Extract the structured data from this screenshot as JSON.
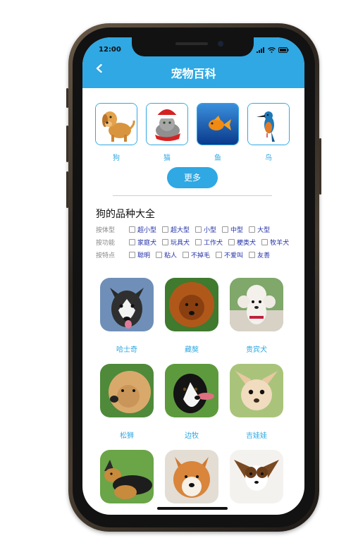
{
  "status": {
    "time": "12:00"
  },
  "header": {
    "title": "宠物百科"
  },
  "categories": [
    {
      "label": "狗"
    },
    {
      "label": "猫"
    },
    {
      "label": "鱼"
    },
    {
      "label": "鸟"
    }
  ],
  "more_button": "更多",
  "section_title": "狗的品种大全",
  "filters": [
    {
      "label": "按体型",
      "options": [
        "超小型",
        "超大型",
        "小型",
        "中型",
        "大型"
      ]
    },
    {
      "label": "按功能",
      "options": [
        "家庭犬",
        "玩具犬",
        "工作犬",
        "梗类犬",
        "牧羊犬"
      ]
    },
    {
      "label": "按特点",
      "options": [
        "聪明",
        "粘人",
        "不掉毛",
        "不爱叫",
        "友善"
      ]
    }
  ],
  "breeds": [
    {
      "name": "哈士奇"
    },
    {
      "name": "藏獒"
    },
    {
      "name": "贵宾犬"
    },
    {
      "name": "松狮"
    },
    {
      "name": "边牧"
    },
    {
      "name": "吉娃娃"
    },
    {
      "name": ""
    },
    {
      "name": ""
    },
    {
      "name": ""
    }
  ],
  "colors": {
    "accent": "#2fa8e3",
    "option_text": "#2230a8"
  }
}
